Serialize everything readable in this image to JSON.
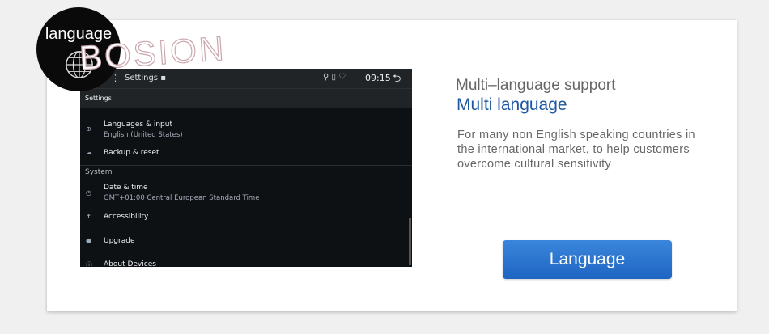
{
  "badge": {
    "label": "language",
    "icon": "globe-icon"
  },
  "watermark": "BOSION",
  "screen": {
    "statusbar": {
      "menu_glyph": "⋮",
      "title": "Settings ▪",
      "icons": "⚲ ▯ ♡",
      "time": "09:15",
      "back_glyph": "⮌"
    },
    "app_title": "Settings",
    "rows": [
      {
        "icon": "globe-icon",
        "glyph": "⊕",
        "title": "Languages & input",
        "subtitle": "English (United States)"
      },
      {
        "icon": "cloud-icon",
        "glyph": "☁",
        "title": "Backup & reset",
        "subtitle": ""
      }
    ],
    "section_system": "System",
    "system_rows": [
      {
        "icon": "clock-icon",
        "glyph": "◷",
        "title": "Date & time",
        "subtitle": "GMT+01:00 Central European Standard Time"
      },
      {
        "icon": "accessibility-icon",
        "glyph": "✝",
        "title": "Accessibility",
        "subtitle": ""
      },
      {
        "icon": "upgrade-icon",
        "glyph": "●",
        "title": "Upgrade",
        "subtitle": ""
      },
      {
        "icon": "info-icon",
        "glyph": "ⓘ",
        "title": "About Devices",
        "subtitle": ""
      }
    ]
  },
  "heading": {
    "subtitle": "Multi–language support",
    "title": "Multi language"
  },
  "description": [
    "For many non English speaking countries in",
    "the international market, to help customers",
    "overcome cultural sensitivity"
  ],
  "button": {
    "label": "Language",
    "color": "#2a74d0"
  }
}
